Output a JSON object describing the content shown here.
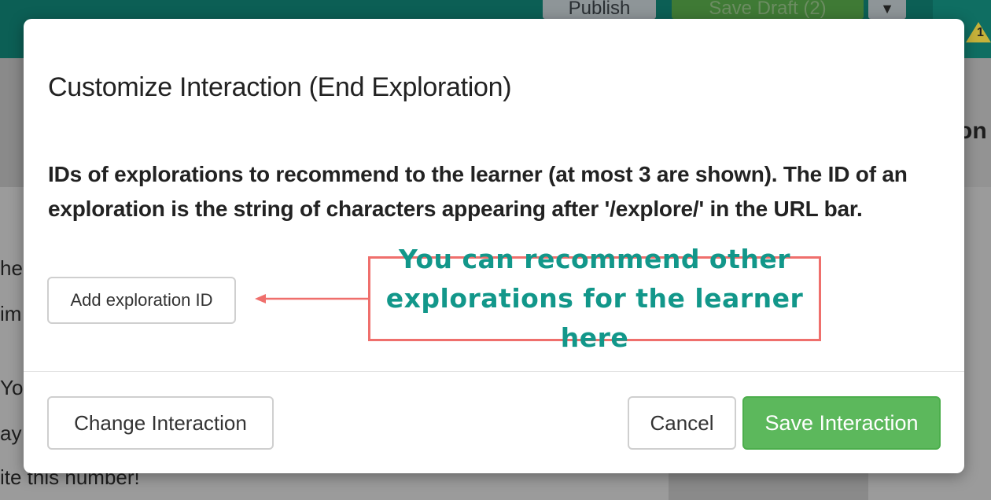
{
  "background": {
    "publish_label": "Publish",
    "save_draft_label": "Save Draft (2)",
    "warning_count": "1",
    "right_fragment": "on C",
    "left_fragments": [
      "he",
      "im",
      "You",
      "ay",
      "ite this number!"
    ]
  },
  "modal": {
    "title": "Customize Interaction (End Exploration)",
    "description": "IDs of explorations to recommend to the learner (at most 3 are shown). The ID of an exploration is the string of characters appearing after '/explore/' in the URL bar.",
    "add_button_label": "Add exploration ID",
    "change_button_label": "Change Interaction",
    "cancel_button_label": "Cancel",
    "save_button_label": "Save Interaction"
  },
  "annotation": {
    "text": "You can recommend other explorations for the learner here",
    "border_color": "#ef6f6c",
    "text_color": "#12978a"
  },
  "colors": {
    "primary_green": "#5cb85c",
    "topbar": "#0c5f55"
  },
  "icons": [
    "chevron-down-icon",
    "pencil-icon",
    "warning-icon",
    "arrow-left-icon"
  ]
}
